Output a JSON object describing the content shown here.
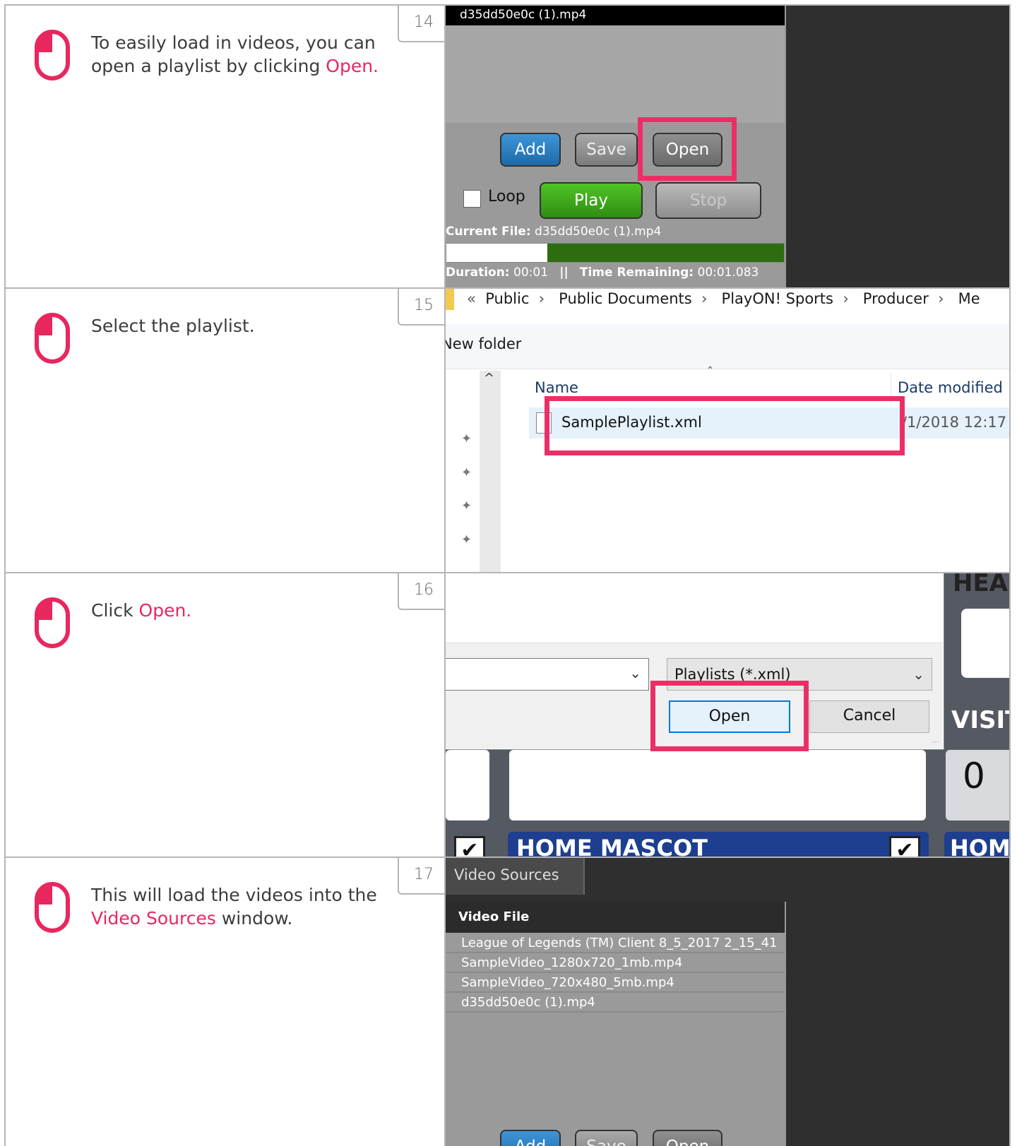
{
  "steps": [
    {
      "num": "14",
      "text_parts": [
        "To easily load in videos, you can open a playlist by clicking ",
        "Open."
      ]
    },
    {
      "num": "15",
      "text_parts": [
        "Select the playlist."
      ]
    },
    {
      "num": "16",
      "text_parts": [
        "Click ",
        "Open."
      ]
    },
    {
      "num": "17",
      "text_parts": [
        "This will load the videos into the ",
        "Video Sources",
        " window."
      ]
    }
  ],
  "panel14": {
    "top_file": "d35dd50e0c (1).mp4",
    "buttons": {
      "add": "Add",
      "save": "Save",
      "open": "Open",
      "play": "Play",
      "stop": "Stop"
    },
    "loop_label": "Loop",
    "loop_checked": false,
    "current_file_label": "Current File:",
    "current_file_value": "d35dd50e0c (1).mp4",
    "progress": 0.3,
    "duration_label": "Duration:",
    "duration_value": "00:01",
    "separator": "||",
    "time_remaining_label": "Time Remaining:",
    "time_remaining_value": "00:01.083"
  },
  "panel15": {
    "breadcrumb": [
      "«",
      "Public",
      "›",
      "Public Documents",
      "›",
      "PlayON! Sports",
      "›",
      "Producer",
      "›",
      "Me"
    ],
    "new_folder": "New folder",
    "col_name": "Name",
    "col_date": "Date modified",
    "file_name": "SamplePlaylist.xml",
    "file_date": "/1/2018 12:17"
  },
  "panel16": {
    "filter": "Playlists (*.xml)",
    "open_btn": "Open",
    "cancel_btn": "Cancel",
    "bg_head": "HEAD",
    "bg_visitor": "VISIT",
    "bg_score": "0",
    "bg_home_mascot": "HOME MASCOT",
    "bg_home": "HOM"
  },
  "panel17": {
    "tab": "Video Sources",
    "header": "Video File",
    "files": [
      "League of Legends (TM) Client 8_5_2017 2_15_41",
      "SampleVideo_1280x720_1mb.mp4",
      "SampleVideo_720x480_5mb.mp4",
      "d35dd50e0c (1).mp4"
    ],
    "buttons": {
      "add": "Add",
      "save": "Save",
      "open": "Open"
    }
  },
  "colors": {
    "accent": "#e8275e",
    "highlight_box": "#ec2e67",
    "add_blue": "#2b7fc4",
    "play_green": "#3aa517"
  }
}
